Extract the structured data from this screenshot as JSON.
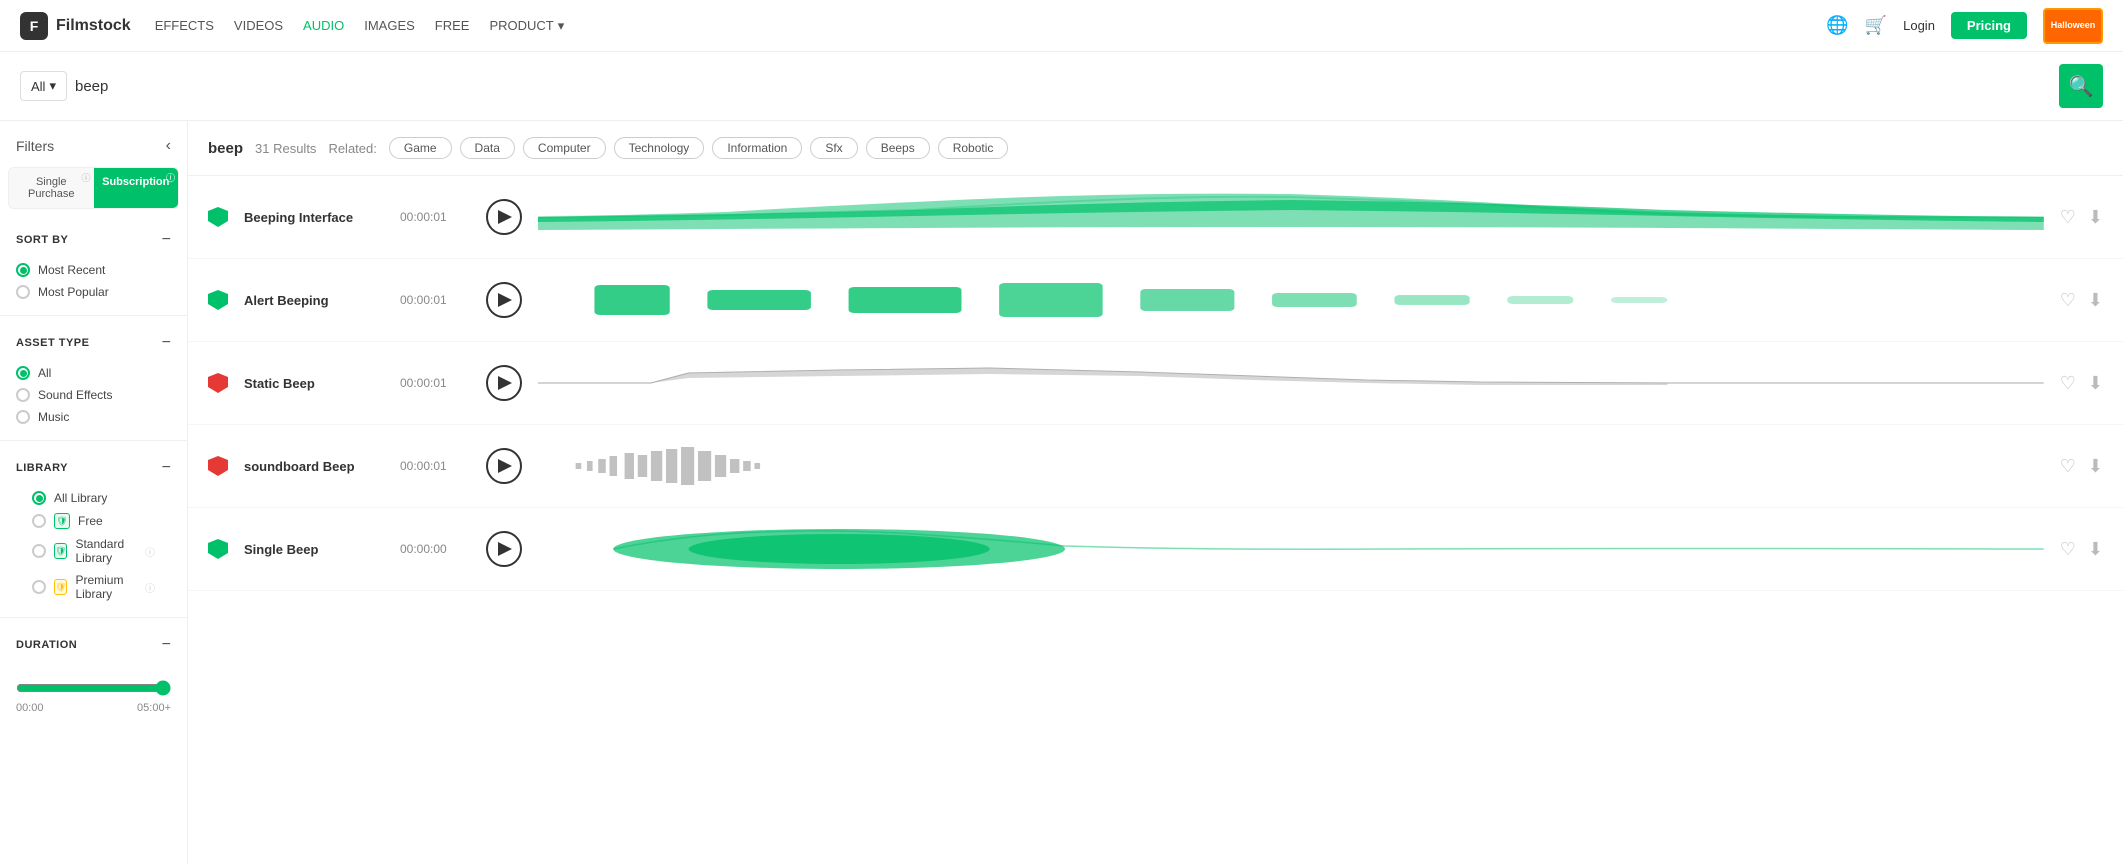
{
  "header": {
    "logo_text": "Filmstock",
    "nav": [
      {
        "label": "EFFECTS",
        "active": false
      },
      {
        "label": "VIDEOS",
        "active": false
      },
      {
        "label": "AUDIO",
        "active": true
      },
      {
        "label": "IMAGES",
        "active": false
      },
      {
        "label": "FREE",
        "active": false
      },
      {
        "label": "PRODUCT",
        "active": false,
        "has_dropdown": true
      }
    ],
    "login_label": "Login",
    "pricing_label": "Pricing",
    "halloween_label": "Halloween"
  },
  "search": {
    "select_value": "All",
    "query": "beep",
    "placeholder": "Search..."
  },
  "sidebar": {
    "filters_label": "Filters",
    "single_purchase_label": "Single Purchase",
    "subscription_label": "Subscription",
    "sort_by_label": "SORT BY",
    "sort_options": [
      {
        "label": "Most Recent",
        "checked": true
      },
      {
        "label": "Most Popular",
        "checked": false
      }
    ],
    "asset_type_label": "ASSET TYPE",
    "asset_options": [
      {
        "label": "All",
        "checked": true
      },
      {
        "label": "Sound Effects",
        "checked": false
      },
      {
        "label": "Music",
        "checked": false
      }
    ],
    "library_label": "LIBRARY",
    "library_options": [
      {
        "label": "All Library",
        "checked": true,
        "badge": null
      },
      {
        "label": "Free",
        "checked": false,
        "badge": "shield-green"
      },
      {
        "label": "Standard Library",
        "checked": false,
        "badge": "shield-green"
      },
      {
        "label": "Premium Library",
        "checked": false,
        "badge": "shield-yellow"
      }
    ],
    "duration_label": "DURATION",
    "duration_min": "00:00",
    "duration_max": "05:00+"
  },
  "results": {
    "search_term": "beep",
    "count": "31 Results",
    "related_label": "Related:",
    "tags": [
      "Game",
      "Data",
      "Computer",
      "Technology",
      "Information",
      "Sfx",
      "Beeps",
      "Robotic"
    ]
  },
  "tracks": [
    {
      "name": "Beeping Interface",
      "duration": "00:00:01",
      "waveform_type": "green_mountain",
      "shield_color": "green"
    },
    {
      "name": "Alert Beeping",
      "duration": "00:00:01",
      "waveform_type": "green_blocks",
      "shield_color": "green"
    },
    {
      "name": "Static Beep",
      "duration": "00:00:01",
      "waveform_type": "gray_flat",
      "shield_color": "red"
    },
    {
      "name": "soundboard Beep",
      "duration": "00:00:01",
      "waveform_type": "gray_noise",
      "shield_color": "red"
    },
    {
      "name": "Single Beep",
      "duration": "00:00:00",
      "waveform_type": "green_blob",
      "shield_color": "green"
    }
  ]
}
